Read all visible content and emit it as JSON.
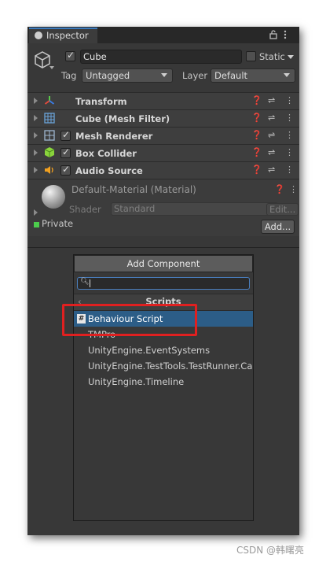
{
  "tab": {
    "title": "Inspector",
    "icons": [
      "info-icon",
      "lock-icon",
      "kebab-icon"
    ]
  },
  "object": {
    "active": true,
    "name": "Cube",
    "static_label": "Static"
  },
  "tag_layer": {
    "tag_label": "Tag",
    "tag_value": "Untagged",
    "layer_label": "Layer",
    "layer_value": "Default"
  },
  "components": [
    {
      "name": "Transform",
      "icon": "transform-icon",
      "checkbox": false
    },
    {
      "name": "Cube (Mesh Filter)",
      "icon": "mesh-filter-icon",
      "checkbox": false
    },
    {
      "name": "Mesh Renderer",
      "icon": "mesh-renderer-icon",
      "checkbox": true
    },
    {
      "name": "Box Collider",
      "icon": "box-collider-icon",
      "checkbox": true
    },
    {
      "name": "Audio Source",
      "icon": "audio-source-icon",
      "checkbox": true
    }
  ],
  "material": {
    "name": "Default-Material (Material)",
    "shader_label": "Shader",
    "shader_value": "Standard",
    "edit_label": "Edit...",
    "private_label": "Private",
    "add_label": "Add..."
  },
  "add_component": {
    "button_label": "Add Component",
    "search_value": "",
    "category": "Scripts",
    "items": [
      "Behaviour Script",
      "TMPro",
      "UnityEngine.EventSystems",
      "UnityEngine.TestTools.TestRunner.Ca",
      "UnityEngine.Timeline"
    ]
  },
  "watermark": "CSDN @韩曙亮",
  "colors": {
    "accent": "#3a79bb",
    "selection": "#2c5d87",
    "highlight_box": "#e02020",
    "panel_bg": "#383838"
  }
}
